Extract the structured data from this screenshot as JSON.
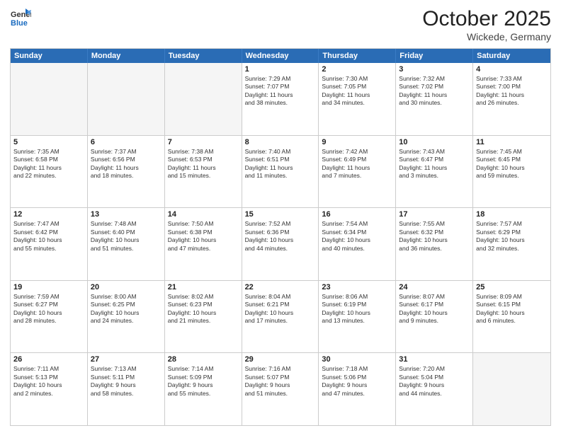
{
  "header": {
    "logo": {
      "general": "General",
      "blue": "Blue"
    },
    "title": "October 2025",
    "location": "Wickede, Germany"
  },
  "weekdays": [
    "Sunday",
    "Monday",
    "Tuesday",
    "Wednesday",
    "Thursday",
    "Friday",
    "Saturday"
  ],
  "weeks": [
    [
      {
        "day": "",
        "info": "",
        "empty": true
      },
      {
        "day": "",
        "info": "",
        "empty": true
      },
      {
        "day": "",
        "info": "",
        "empty": true
      },
      {
        "day": "1",
        "info": "Sunrise: 7:29 AM\nSunset: 7:07 PM\nDaylight: 11 hours\nand 38 minutes."
      },
      {
        "day": "2",
        "info": "Sunrise: 7:30 AM\nSunset: 7:05 PM\nDaylight: 11 hours\nand 34 minutes."
      },
      {
        "day": "3",
        "info": "Sunrise: 7:32 AM\nSunset: 7:02 PM\nDaylight: 11 hours\nand 30 minutes."
      },
      {
        "day": "4",
        "info": "Sunrise: 7:33 AM\nSunset: 7:00 PM\nDaylight: 11 hours\nand 26 minutes."
      }
    ],
    [
      {
        "day": "5",
        "info": "Sunrise: 7:35 AM\nSunset: 6:58 PM\nDaylight: 11 hours\nand 22 minutes."
      },
      {
        "day": "6",
        "info": "Sunrise: 7:37 AM\nSunset: 6:56 PM\nDaylight: 11 hours\nand 18 minutes."
      },
      {
        "day": "7",
        "info": "Sunrise: 7:38 AM\nSunset: 6:53 PM\nDaylight: 11 hours\nand 15 minutes."
      },
      {
        "day": "8",
        "info": "Sunrise: 7:40 AM\nSunset: 6:51 PM\nDaylight: 11 hours\nand 11 minutes."
      },
      {
        "day": "9",
        "info": "Sunrise: 7:42 AM\nSunset: 6:49 PM\nDaylight: 11 hours\nand 7 minutes."
      },
      {
        "day": "10",
        "info": "Sunrise: 7:43 AM\nSunset: 6:47 PM\nDaylight: 11 hours\nand 3 minutes."
      },
      {
        "day": "11",
        "info": "Sunrise: 7:45 AM\nSunset: 6:45 PM\nDaylight: 10 hours\nand 59 minutes."
      }
    ],
    [
      {
        "day": "12",
        "info": "Sunrise: 7:47 AM\nSunset: 6:42 PM\nDaylight: 10 hours\nand 55 minutes."
      },
      {
        "day": "13",
        "info": "Sunrise: 7:48 AM\nSunset: 6:40 PM\nDaylight: 10 hours\nand 51 minutes."
      },
      {
        "day": "14",
        "info": "Sunrise: 7:50 AM\nSunset: 6:38 PM\nDaylight: 10 hours\nand 47 minutes."
      },
      {
        "day": "15",
        "info": "Sunrise: 7:52 AM\nSunset: 6:36 PM\nDaylight: 10 hours\nand 44 minutes."
      },
      {
        "day": "16",
        "info": "Sunrise: 7:54 AM\nSunset: 6:34 PM\nDaylight: 10 hours\nand 40 minutes."
      },
      {
        "day": "17",
        "info": "Sunrise: 7:55 AM\nSunset: 6:32 PM\nDaylight: 10 hours\nand 36 minutes."
      },
      {
        "day": "18",
        "info": "Sunrise: 7:57 AM\nSunset: 6:29 PM\nDaylight: 10 hours\nand 32 minutes."
      }
    ],
    [
      {
        "day": "19",
        "info": "Sunrise: 7:59 AM\nSunset: 6:27 PM\nDaylight: 10 hours\nand 28 minutes."
      },
      {
        "day": "20",
        "info": "Sunrise: 8:00 AM\nSunset: 6:25 PM\nDaylight: 10 hours\nand 24 minutes."
      },
      {
        "day": "21",
        "info": "Sunrise: 8:02 AM\nSunset: 6:23 PM\nDaylight: 10 hours\nand 21 minutes."
      },
      {
        "day": "22",
        "info": "Sunrise: 8:04 AM\nSunset: 6:21 PM\nDaylight: 10 hours\nand 17 minutes."
      },
      {
        "day": "23",
        "info": "Sunrise: 8:06 AM\nSunset: 6:19 PM\nDaylight: 10 hours\nand 13 minutes."
      },
      {
        "day": "24",
        "info": "Sunrise: 8:07 AM\nSunset: 6:17 PM\nDaylight: 10 hours\nand 9 minutes."
      },
      {
        "day": "25",
        "info": "Sunrise: 8:09 AM\nSunset: 6:15 PM\nDaylight: 10 hours\nand 6 minutes."
      }
    ],
    [
      {
        "day": "26",
        "info": "Sunrise: 7:11 AM\nSunset: 5:13 PM\nDaylight: 10 hours\nand 2 minutes."
      },
      {
        "day": "27",
        "info": "Sunrise: 7:13 AM\nSunset: 5:11 PM\nDaylight: 9 hours\nand 58 minutes."
      },
      {
        "day": "28",
        "info": "Sunrise: 7:14 AM\nSunset: 5:09 PM\nDaylight: 9 hours\nand 55 minutes."
      },
      {
        "day": "29",
        "info": "Sunrise: 7:16 AM\nSunset: 5:07 PM\nDaylight: 9 hours\nand 51 minutes."
      },
      {
        "day": "30",
        "info": "Sunrise: 7:18 AM\nSunset: 5:06 PM\nDaylight: 9 hours\nand 47 minutes."
      },
      {
        "day": "31",
        "info": "Sunrise: 7:20 AM\nSunset: 5:04 PM\nDaylight: 9 hours\nand 44 minutes."
      },
      {
        "day": "",
        "info": "",
        "empty": true
      }
    ]
  ]
}
